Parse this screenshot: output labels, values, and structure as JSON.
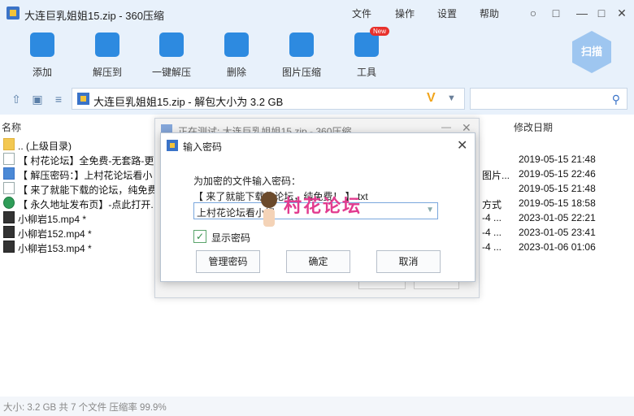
{
  "window": {
    "title": "大连巨乳姐姐15.zip - 360压缩",
    "menu": [
      "文件",
      "操作",
      "设置",
      "帮助"
    ],
    "controls": [
      "shirt-icon",
      "message-icon",
      "minimize-icon",
      "maximize-icon",
      "close-icon"
    ]
  },
  "toolbar": {
    "items": [
      {
        "label": "添加",
        "icon": "add-icon"
      },
      {
        "label": "解压到",
        "icon": "extract-to-icon"
      },
      {
        "label": "一键解压",
        "icon": "one-click-extract-icon"
      },
      {
        "label": "删除",
        "icon": "trash-icon"
      },
      {
        "label": "图片压缩",
        "icon": "image-compress-icon"
      },
      {
        "label": "工具",
        "icon": "tools-icon"
      }
    ],
    "new_badge": "New",
    "scan_label": "扫描"
  },
  "address": {
    "path": "大连巨乳姐姐15.zip - 解包大小为 3.2 GB",
    "v_mark": "V"
  },
  "columns": {
    "name": "名称",
    "modified": "修改日期"
  },
  "files": [
    {
      "name": ".. (上级目录)",
      "type": "folder",
      "extra": "",
      "date": ""
    },
    {
      "name": "【 村花论坛】全免费-无套路-更",
      "type": "txt",
      "extra": "",
      "date": "2019-05-15 21:48"
    },
    {
      "name": "【 解压密码：】上村花论坛看小",
      "type": "jpg",
      "extra": "图片...",
      "date": "2019-05-15 22:46"
    },
    {
      "name": "【 来了就能下载的论坛，纯免费",
      "type": "txt",
      "extra": "",
      "date": "2019-05-15 21:48"
    },
    {
      "name": "【 永久地址发布页】-点此打开.",
      "type": "globe",
      "extra": "方式",
      "date": "2019-05-15 18:58"
    },
    {
      "name": "小柳岩15.mp4 *",
      "type": "mp4",
      "extra": "-4 ...",
      "date": "2023-01-05 22:21"
    },
    {
      "name": "小柳岩152.mp4 *",
      "type": "mp4",
      "extra": "-4 ...",
      "date": "2023-01-05 23:41"
    },
    {
      "name": "小柳岩153.mp4 *",
      "type": "mp4",
      "extra": "-4 ...",
      "date": "2023-01-06 01:06"
    }
  ],
  "status": "大小: 3.2 GB 共 7 个文件 压缩率 99.9%",
  "testing_window": {
    "title": "正在测试: 大连巨乳姐姐15.zip - 360压缩"
  },
  "dialog": {
    "title": "输入密码",
    "prompt": "为加密的文件输入密码：",
    "filename": "【 来了就能下载的论坛，纯免费！ 】.txt",
    "password_value": "上村花论坛看小视",
    "show_password_label": "显示密码",
    "show_password_checked": true,
    "buttons": {
      "manage": "管理密码",
      "ok": "确定",
      "cancel": "取消"
    }
  },
  "watermark": "村花论坛"
}
